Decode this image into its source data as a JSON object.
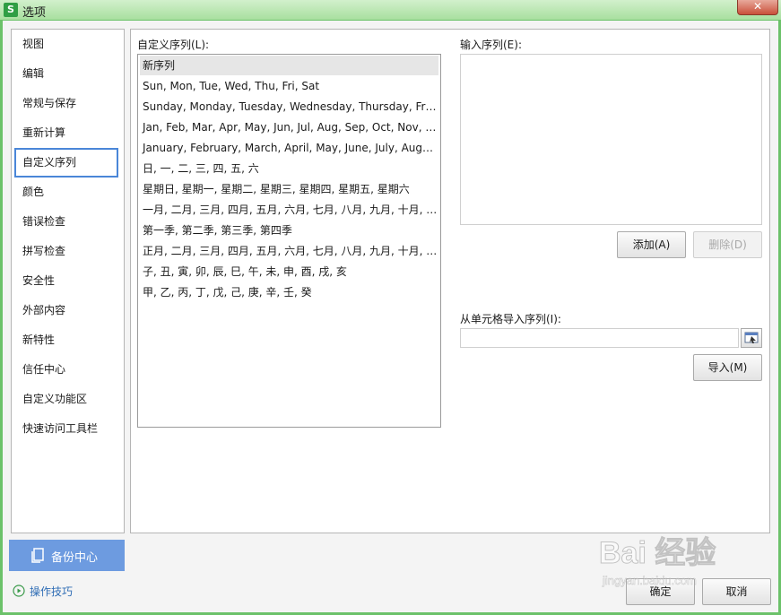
{
  "window": {
    "title": "选项",
    "app_icon": "S",
    "close_glyph": "✕"
  },
  "sidebar": {
    "items": [
      {
        "label": "视图"
      },
      {
        "label": "编辑"
      },
      {
        "label": "常规与保存"
      },
      {
        "label": "重新计算"
      },
      {
        "label": "自定义序列",
        "active": true
      },
      {
        "label": "颜色"
      },
      {
        "label": "错误检查"
      },
      {
        "label": "拼写检查"
      },
      {
        "label": "安全性"
      },
      {
        "label": "外部内容"
      },
      {
        "label": "新特性"
      },
      {
        "label": "信任中心"
      },
      {
        "label": "自定义功能区"
      },
      {
        "label": "快速访问工具栏"
      }
    ],
    "backup_label": "备份中心",
    "tips_label": "操作技巧"
  },
  "custom_lists": {
    "label": "自定义序列(L):",
    "items": [
      "新序列",
      "Sun, Mon, Tue, Wed, Thu, Fri, Sat",
      "Sunday, Monday, Tuesday, Wednesday, Thursday, Friday, Saturday",
      "Jan, Feb, Mar, Apr, May, Jun, Jul, Aug, Sep, Oct, Nov, Dec",
      "January, February, March, April, May, June, July, August, September, October, November, December",
      "日, 一, 二, 三, 四, 五, 六",
      "星期日, 星期一, 星期二, 星期三, 星期四, 星期五, 星期六",
      "一月, 二月, 三月, 四月, 五月, 六月, 七月, 八月, 九月, 十月, 十一月, 十二月",
      "第一季, 第二季, 第三季, 第四季",
      "正月, 二月, 三月, 四月, 五月, 六月, 七月, 八月, 九月, 十月, 冬月, 腊月",
      "子, 丑, 寅, 卯, 辰, 巳, 午, 未, 申, 酉, 戌, 亥",
      "甲, 乙, 丙, 丁, 戊, 己, 庚, 辛, 壬, 癸"
    ],
    "selected_index": 0
  },
  "entry": {
    "label": "输入序列(E):",
    "value": "",
    "add_label": "添加(A)",
    "delete_label": "删除(D)"
  },
  "import": {
    "label": "从单元格导入序列(I):",
    "value": "",
    "import_label": "导入(M)"
  },
  "footer": {
    "ok_label": "确定",
    "cancel_label": "取消"
  },
  "watermark": {
    "text": "Bai 经验",
    "sub": "jingyan.baidu.com"
  },
  "colors": {
    "title_bar": "#a8df9f",
    "frame": "#6cc26a",
    "backup_button": "#6d9be0",
    "active_border": "#4a86d8",
    "link": "#2f6db5"
  }
}
